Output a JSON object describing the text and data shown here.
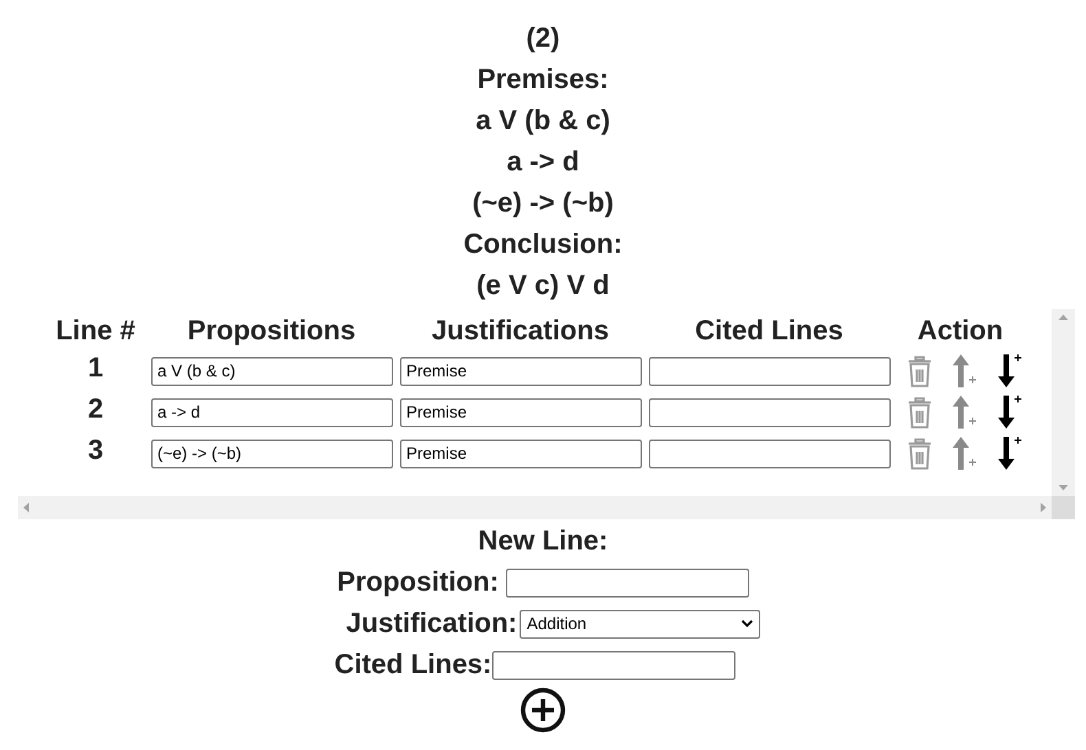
{
  "problem": {
    "number": "(2)",
    "premises_label": "Premises:",
    "premises": [
      "a V (b & c)",
      "a -> d",
      "(~e) -> (~b)"
    ],
    "conclusion_label": "Conclusion:",
    "conclusion": "(e V c) V d"
  },
  "table": {
    "columns": [
      "Line #",
      "Propositions",
      "Justifications",
      "Cited Lines",
      "Action"
    ],
    "rows": [
      {
        "line": "1",
        "proposition": "a V (b & c)",
        "justification": "Premise",
        "cited_lines": ""
      },
      {
        "line": "2",
        "proposition": "a -> d",
        "justification": "Premise",
        "cited_lines": ""
      },
      {
        "line": "3",
        "proposition": "(~e) -> (~b)",
        "justification": "Premise",
        "cited_lines": ""
      }
    ]
  },
  "new_line": {
    "title": "New Line:",
    "proposition_label": "Proposition:",
    "justification_label": "Justification:",
    "justification_value": "Addition",
    "cited_label": "Cited Lines:"
  }
}
